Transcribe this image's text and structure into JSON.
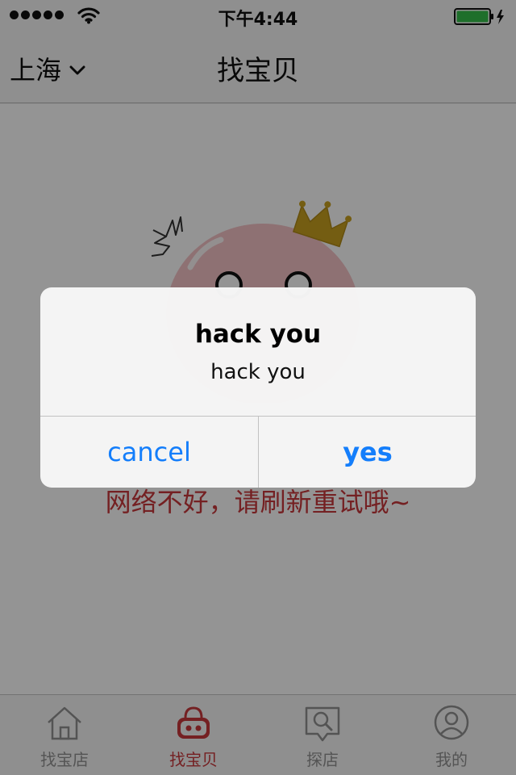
{
  "status_bar": {
    "time": "下午4:44",
    "signal_icon": "signal-dots-icon",
    "wifi_icon": "wifi-icon",
    "battery_icon": "battery-charging-icon",
    "battery_color": "#34c04a"
  },
  "nav_bar": {
    "city": "上海",
    "city_dropdown_icon": "chevron-down-icon",
    "title": "找宝贝"
  },
  "content": {
    "mascot": "crowned-bubble-mascot",
    "error_message": "网络不好，请刷新重试哦~"
  },
  "tab_bar": {
    "items": [
      {
        "label": "找宝店",
        "icon": "home-icon",
        "active": false
      },
      {
        "label": "找宝贝",
        "icon": "shopping-basket-icon",
        "active": true
      },
      {
        "label": "探店",
        "icon": "search-bubble-icon",
        "active": false
      },
      {
        "label": "我的",
        "icon": "profile-icon",
        "active": false
      }
    ]
  },
  "alert": {
    "title": "hack you",
    "message": "hack you",
    "cancel_label": "cancel",
    "confirm_label": "yes"
  },
  "colors": {
    "accent_red": "#c9383c",
    "ios_blue": "#147efb",
    "crown_gold": "#c9a020",
    "mascot_pink": "#f4c3c7"
  }
}
